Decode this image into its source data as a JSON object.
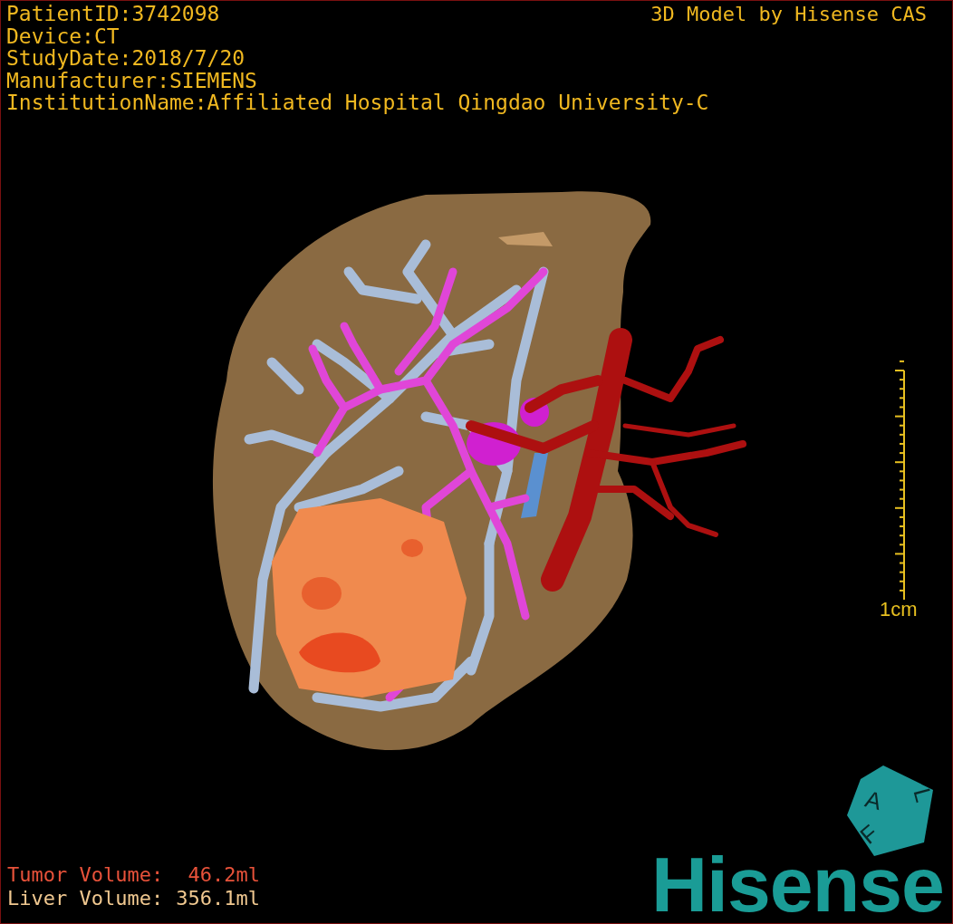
{
  "info_lines": [
    "PatientID:3742098",
    "Device:CT",
    "StudyDate:2018/7/20",
    "Manufacturer:SIEMENS",
    "InstitutionName:Affiliated Hospital Qingdao University-C"
  ],
  "header_right": "3D Model by Hisense CAS",
  "scale_bar": {
    "label": "1cm"
  },
  "volumes": [
    {
      "label": "Tumor Volume:",
      "value": "46.2ml",
      "color": "#e8523a"
    },
    {
      "label": "Liver Volume:",
      "value": "356.1ml",
      "color": "#f0c890"
    }
  ],
  "orientation_cube": {
    "letters": [
      "A",
      "L",
      "F"
    ]
  },
  "logo": "Hisense"
}
